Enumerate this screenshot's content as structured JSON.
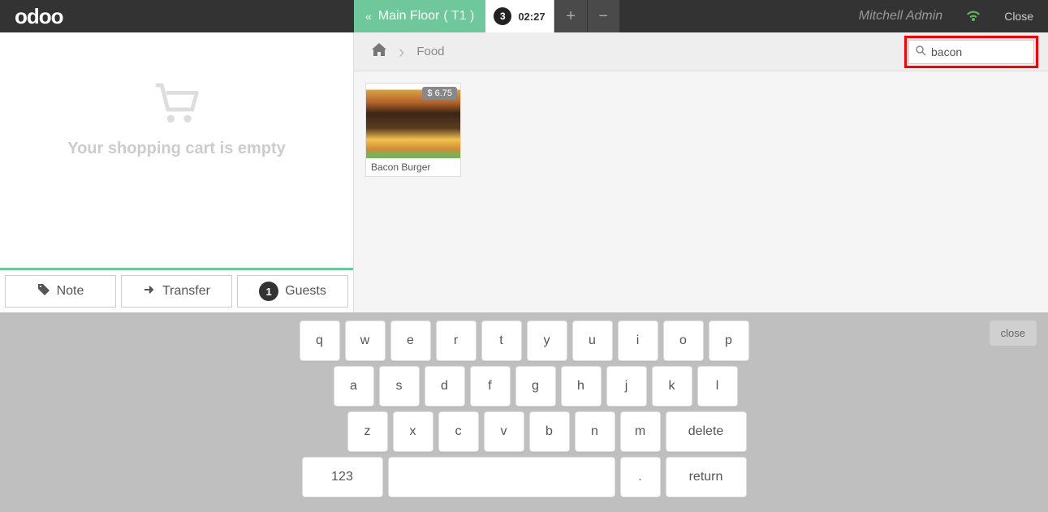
{
  "header": {
    "logo_text": "odoo",
    "floor_label": "Main Floor",
    "table_label": "( T1 )",
    "order_number": "3",
    "order_time": "02:27",
    "user_name": "Mitchell Admin",
    "close_label": "Close"
  },
  "cart": {
    "empty_message": "Your shopping cart is empty",
    "note_label": "Note",
    "transfer_label": "Transfer",
    "guests_label": "Guests",
    "guests_count": "1"
  },
  "breadcrumb": {
    "category": "Food"
  },
  "search": {
    "value": "bacon"
  },
  "products": [
    {
      "name": "Bacon Burger",
      "price": "$ 6.75"
    }
  ],
  "keyboard": {
    "close_label": "close",
    "row1": [
      "q",
      "w",
      "e",
      "r",
      "t",
      "y",
      "u",
      "i",
      "o",
      "p"
    ],
    "row2": [
      "a",
      "s",
      "d",
      "f",
      "g",
      "h",
      "j",
      "k",
      "l"
    ],
    "row3": [
      "z",
      "x",
      "c",
      "v",
      "b",
      "n",
      "m"
    ],
    "delete_label": "delete",
    "numeric_label": "123",
    "period_label": ".",
    "return_label": "return"
  }
}
